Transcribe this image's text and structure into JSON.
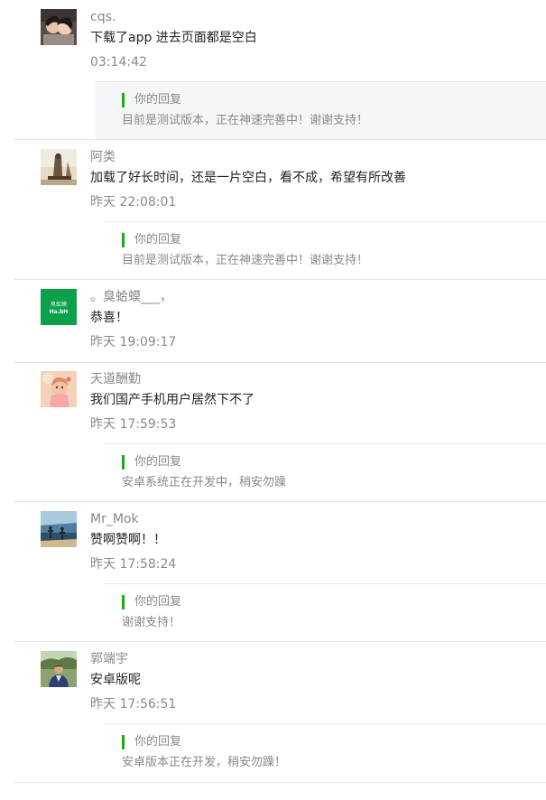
{
  "reply_label": "你的回复",
  "accent_color": "#1aad19",
  "comments": [
    {
      "nickname": "cqs.",
      "content": "下载了app 进去页面都是空白",
      "time": "03:14:42",
      "reply": "目前是测试版本，正在神速完善中！谢谢支持！",
      "avatar_icon": "couple-photo-icon"
    },
    {
      "nickname": "阿类",
      "content": "加载了好长时间，还是一片空白，看不成，希望有所改善",
      "time": "昨天 22:08:01",
      "reply": "目前是测试版本，正在神速完善中！谢谢支持！",
      "avatar_icon": "statue-photo-icon"
    },
    {
      "nickname": "。臭蛤蟆___，",
      "content": "恭喜！",
      "time": "昨天 19:09:17",
      "reply": "",
      "avatar_icon": "green-logo-icon",
      "avatar_text": [
        "臭蛤蟆",
        "Ha.bH"
      ]
    },
    {
      "nickname": "天道酬勤",
      "content": "我们国产手机用户居然下不了",
      "time": "昨天 17:59:53",
      "reply": "安卓系统正在开发中，稍安勿躁",
      "avatar_icon": "baby-photo-icon"
    },
    {
      "nickname": "Mr_Mok",
      "content": "赞啊赞啊！！",
      "time": "昨天 17:58:24",
      "reply": "谢谢支持！",
      "avatar_icon": "beach-photo-icon"
    },
    {
      "nickname": "郭端宇",
      "content": "安卓版呢",
      "time": "昨天 17:56:51",
      "reply": "安卓版本正在开发，稍安勿躁！",
      "avatar_icon": "man-photo-icon"
    }
  ]
}
